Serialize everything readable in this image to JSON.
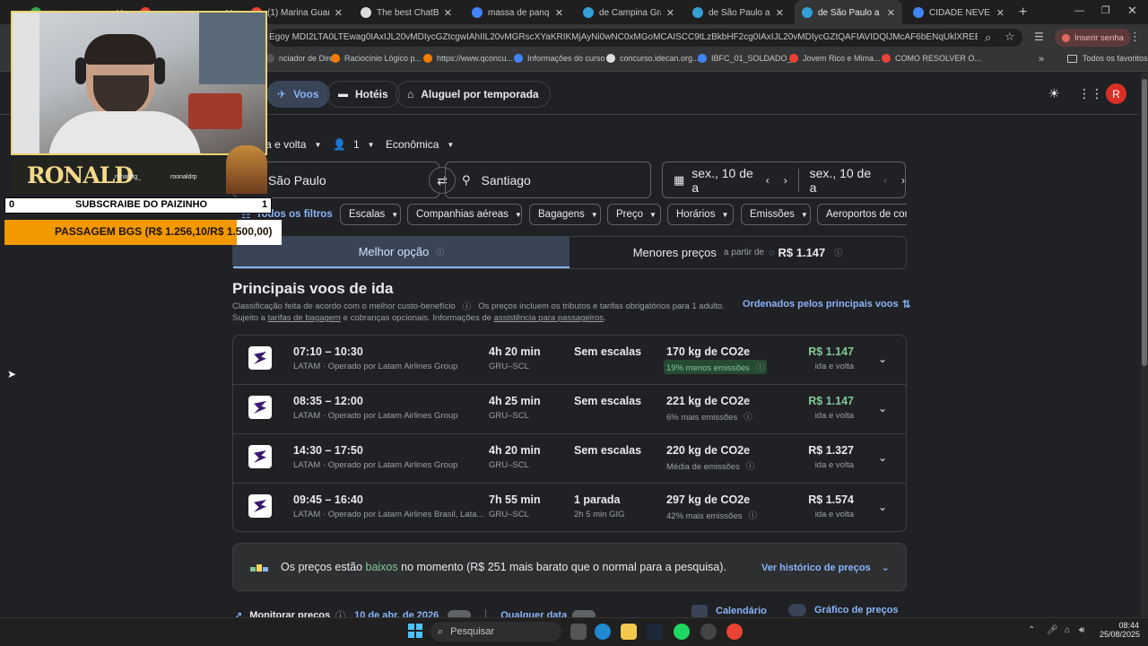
{
  "browser": {
    "tabs": [
      {
        "title": "",
        "icon": "green"
      },
      {
        "title": "",
        "icon": "red"
      },
      {
        "title": "(1) Marina Guaragna",
        "icon": "red"
      },
      {
        "title": "The best ChatBot and",
        "icon": "bot"
      },
      {
        "title": "massa de panqueca",
        "icon": "google"
      },
      {
        "title": "de Campina Grande",
        "icon": "flights"
      },
      {
        "title": "de São Paulo a Chile",
        "icon": "flights"
      },
      {
        "title": "de São Paulo a Santi",
        "icon": "flights"
      },
      {
        "title": "CIDADE NEVE - Pesq",
        "icon": "google"
      }
    ],
    "new_tab": "+",
    "url": "Egoy MDI2LTA0LTEwag0IAxIJL20vMDIycGZtcgwIAhIIL20vMGRscXYaKRIKMjAyNi0wNC0xMGoMCAISCC9tLzBkbHF2cg0IAxIJL20vMDIycGZtQAFIAVIDQlJMcAF6bENqUklXREEwYzBaSFIxWnRiRmxC",
    "incognito_label": "Inserir senha",
    "avatar_letter": "R",
    "bookmarks": [
      "nciador de Dire...",
      "Raciocínio Lógico p...",
      "https://www.qconcu...",
      "Informações do curso",
      "concurso.idecan.org...",
      "IBFC_01_SOLDADO_...",
      "Jovem Rico e Mima...",
      "COMO RESOLVER O..."
    ],
    "all_favorites": "Todos os favoritos"
  },
  "overlay": {
    "name_banner": "RONALD",
    "social1": "ronaldtg_",
    "social2": "roonaldrp",
    "sub_left": "0",
    "sub_text": "SUBSCRAIBE DO PAIZINHO",
    "sub_right": "1",
    "goal_text": "PASSAGEM BGS (R$ 1.256,10/R$ 1.500,00)",
    "goal_progress": 0.8374
  },
  "nav": {
    "voos": "Voos",
    "hoteis": "Hotéis",
    "aluguel": "Aluguel por temporada",
    "profile_letter": "R"
  },
  "search": {
    "trip_type": "Ida e volta",
    "passengers": "1",
    "cabin": "Econômica",
    "origin": "São Paulo",
    "destination": "Santiago",
    "depart_date": "sex., 10 de a",
    "return_date": "sex., 10 de a"
  },
  "filters": {
    "all": "Todos os filtros",
    "items": [
      "Escalas",
      "Companhias aéreas",
      "Bagagens",
      "Preço",
      "Horários",
      "Emissões",
      "Aeroportos de con"
    ]
  },
  "sort_tabs": {
    "best": "Melhor opção",
    "cheapest": "Menores preços",
    "from_label": "a partir de",
    "from_price": "R$ 1.147"
  },
  "results": {
    "heading": "Principais voos de ida",
    "subtitle_1": "Classificação feita de acordo com o melhor custo-benefício",
    "subtitle_2": "Os preços incluem os tributos e tarifas obrigatórios para 1 adulto.",
    "subtitle_3": "Sujeito a",
    "baggage_link": "tarifas de bagagem",
    "subtitle_4": "e cobranças opcionais. Informações de",
    "assist_link": "assistência para passageiros",
    "sort_label": "Ordenados pelos principais voos",
    "flights": [
      {
        "times": "07:10 – 10:30",
        "airline": "LATAM · Operado por Latam Airlines Group",
        "duration": "4h 20 min",
        "route": "GRU–SCL",
        "stops": "Sem escalas",
        "stops_sub": "",
        "co2": "170 kg de CO2e",
        "co2_sub": "19% menos emissões",
        "co2_highlight": true,
        "price": "R$ 1.147",
        "price_green": true,
        "price_sub": "ida e volta"
      },
      {
        "times": "08:35 – 12:00",
        "airline": "LATAM · Operado por Latam Airlines Group",
        "duration": "4h 25 min",
        "route": "GRU–SCL",
        "stops": "Sem escalas",
        "stops_sub": "",
        "co2": "221 kg de CO2e",
        "co2_sub": "6% mais emissões",
        "co2_highlight": false,
        "price": "R$ 1.147",
        "price_green": true,
        "price_sub": "ida e volta"
      },
      {
        "times": "14:30 – 17:50",
        "airline": "LATAM · Operado por Latam Airlines Group",
        "duration": "4h 20 min",
        "route": "GRU–SCL",
        "stops": "Sem escalas",
        "stops_sub": "",
        "co2": "220 kg de CO2e",
        "co2_sub": "Média de emissões",
        "co2_highlight": false,
        "price": "R$ 1.327",
        "price_green": false,
        "price_sub": "ida e volta"
      },
      {
        "times": "09:45 – 16:40",
        "airline": "LATAM · Operado por Latam Airlines Brasil, Lata...",
        "duration": "7h 55 min",
        "route": "GRU–SCL",
        "stops": "1 parada",
        "stops_sub": "2h 5 min GIG",
        "co2": "297 kg de CO2e",
        "co2_sub": "42% mais emissões",
        "co2_highlight": false,
        "price": "R$ 1.574",
        "price_green": false,
        "price_sub": "ida e volta"
      }
    ]
  },
  "insight": {
    "text_before": "Os preços estão",
    "level": "baixos",
    "text_after": "no momento (R$ 251 mais barato que o normal para a pesquisa).",
    "link": "Ver histórico de preços"
  },
  "bottom": {
    "monitor": "Monitorar preços",
    "date": "10 de abr. de 2026",
    "any_date": "Qualquer data",
    "calendar": "Calendário",
    "price_graph": "Gráfico de preços"
  },
  "taskbar": {
    "search": "Pesquisar",
    "time": "08:44",
    "date": "25/08/2025"
  },
  "colors": {
    "accent": "#8ab4f8",
    "green": "#81c995",
    "goal_orange": "#f29900",
    "latam": "#3b1a6e"
  }
}
